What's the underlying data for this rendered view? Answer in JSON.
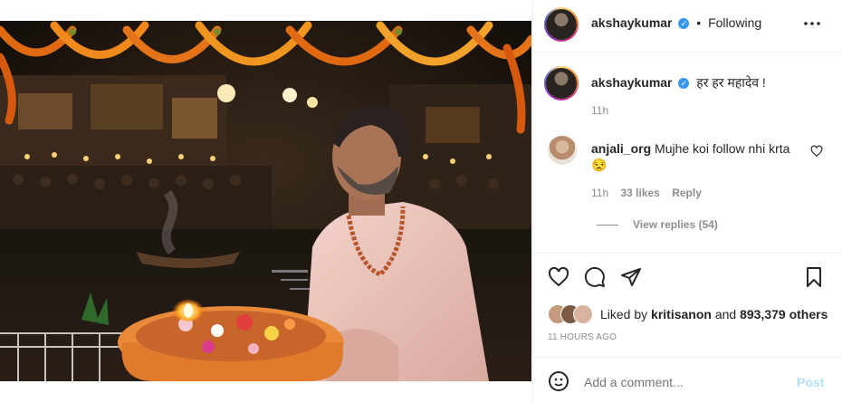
{
  "post": {
    "author": "akshaykumar",
    "follow_separator": "•",
    "follow_status": "Following",
    "more_icon": "more-horizontal-icon",
    "caption": {
      "username": "akshaykumar",
      "text": "हर हर महादेव !",
      "time": "11h"
    },
    "comments": [
      {
        "username": "anjali_org",
        "text": "Mujhe koi follow nhi krta",
        "emoji": "😒",
        "time": "11h",
        "likes": "33 likes",
        "reply_label": "Reply",
        "view_replies": "View replies (54)"
      }
    ],
    "actions": {
      "like_icon": "heart-icon",
      "comment_icon": "comment-icon",
      "share_icon": "paper-plane-icon",
      "save_icon": "bookmark-icon"
    },
    "likes": {
      "prefix": "Liked by",
      "user": "kritisanon",
      "joiner": "and",
      "others": "893,379 others"
    },
    "timestamp": "11 HOURS AGO",
    "comment_box": {
      "placeholder": "Add a comment...",
      "post_label": "Post",
      "emoji_icon": "smiley-icon"
    }
  },
  "colors": {
    "verified": "#3897f0",
    "link": "#0095f6",
    "post_disabled": "#b2dffc",
    "muted": "#8e8e8e"
  }
}
